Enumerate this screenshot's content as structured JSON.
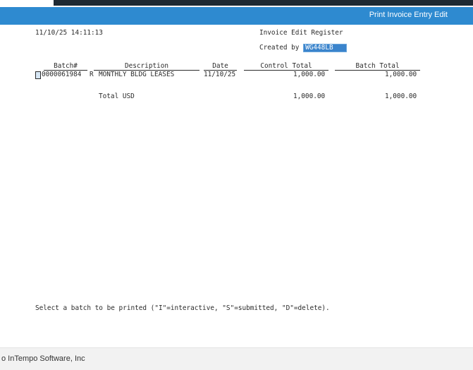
{
  "window": {
    "title": "Print Invoice Entry Edit"
  },
  "report": {
    "timestamp": "11/10/25 14:11:13",
    "heading": "Invoice Edit Register",
    "created_by_label": "Created by",
    "created_by_user": "WG448LB"
  },
  "table": {
    "columns": [
      "Batch#",
      "Description",
      "Date",
      "Control Total",
      "Batch Total"
    ],
    "rows": [
      {
        "select": "",
        "batch": "0000061984",
        "flag": "R",
        "description": "MONTHLY BLDG LEASES",
        "date": "11/10/25",
        "control_total": "1,000.00",
        "batch_total": "1,000.00"
      }
    ],
    "total": {
      "label": "Total USD",
      "control_total": "1,000.00",
      "batch_total": "1,000.00"
    }
  },
  "instructions": "Select a batch to be printed (\"I\"=interactive, \"S\"=submitted, \"D\"=delete).",
  "footer": {
    "copyright": "o InTempo Software, Inc"
  }
}
